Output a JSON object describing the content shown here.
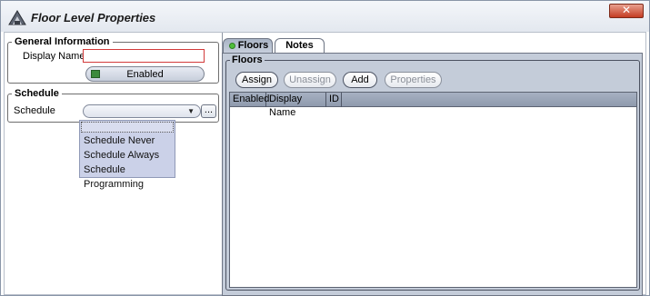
{
  "window": {
    "title": "Floor Level Properties",
    "close_glyph": "✕"
  },
  "general_info": {
    "legend": "General Information",
    "display_name_label": "Display Name:",
    "display_name_value": "",
    "enabled_label": "Enabled"
  },
  "schedule": {
    "legend": "Schedule",
    "label": "Schedule",
    "selected_value": "",
    "ellipsis": "...",
    "options": [
      "",
      "Schedule Never",
      "Schedule Always",
      "Schedule Programming"
    ]
  },
  "tabs": [
    {
      "label": "Floors",
      "active": true
    },
    {
      "label": "Notes",
      "active": false
    }
  ],
  "floors": {
    "legend": "Floors",
    "buttons": {
      "assign": "Assign",
      "unassign": "Unassign",
      "add": "Add",
      "properties": "Properties"
    },
    "columns": [
      "Enabled",
      "Display Name",
      "ID"
    ],
    "rows": []
  },
  "colors": {
    "accent_panel": "#c4ccd9",
    "close_button": "#c43c22",
    "dropdown_bg": "#cbd1e8",
    "status_dot": "#4fbf3a"
  },
  "icons": {
    "app": "floor-level-app-icon",
    "close": "close-icon",
    "dropdown": "chevron-down-icon",
    "enabled_check": "checkbox-icon",
    "tab_status": "status-dot-icon"
  }
}
